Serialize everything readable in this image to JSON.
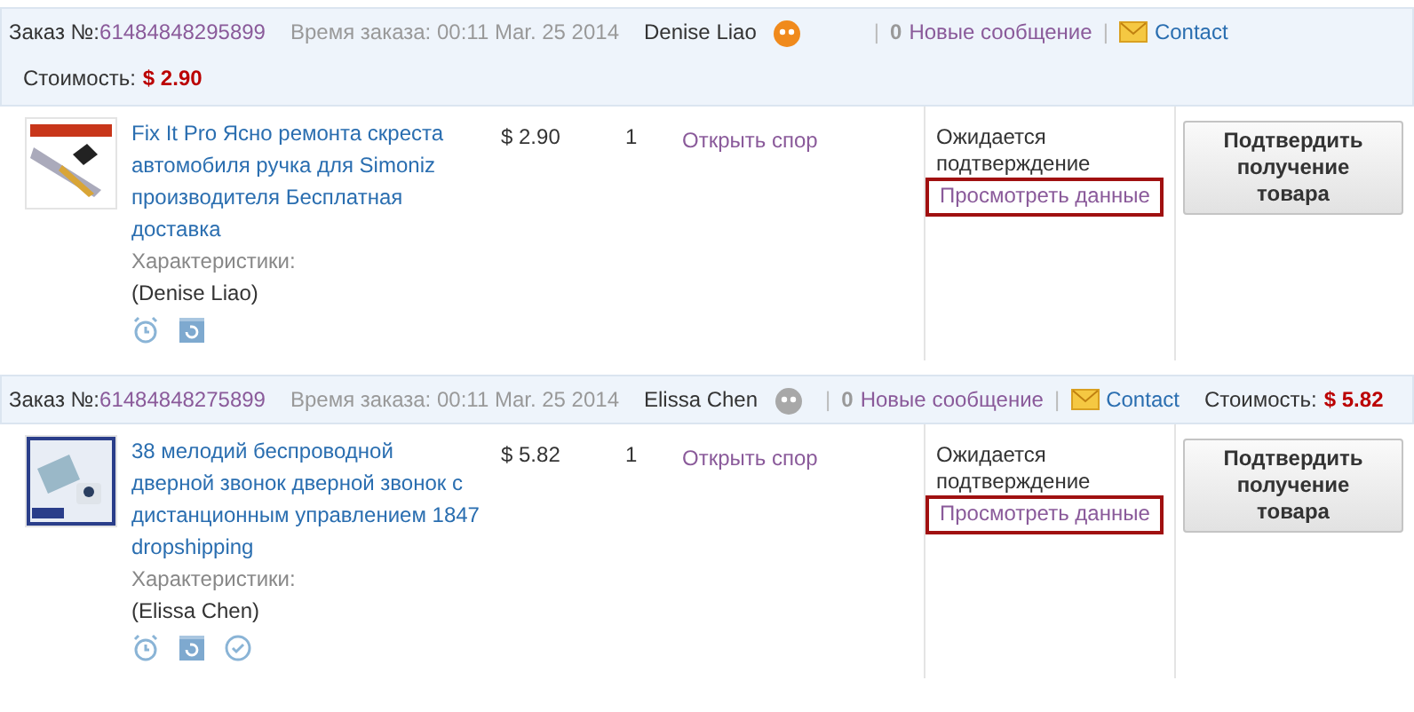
{
  "orders": [
    {
      "order_label": "Заказ №:",
      "order_number": "61484848295899",
      "time_label": "Время заказа: 00:11 Mar. 25 2014",
      "seller": "Denise Liao",
      "seller_online": true,
      "separator_1": "|",
      "messages_count": "0",
      "messages_label": "Новые сообщение",
      "separator_2": "|",
      "contact": "Contact",
      "cost_label": "Стоимость:",
      "cost": "$ 2.90",
      "cost_on_second_line": true,
      "item": {
        "title": "Fix It Pro Ясно ремонта скреста автомобиля ручка для Simoniz производителя Бесплатная доставка",
        "specs_label": "Характеристики:",
        "specs_value": "(Denise Liao)",
        "price": "$ 2.90",
        "quantity": "1",
        "dispute": "Открыть спор",
        "status": "Ожидается подтверждение",
        "details_link": "Просмотреть данные",
        "details_highlighted": true,
        "confirm_button": "Подтвердить получение товара",
        "icons": [
          {
            "kind": "alarm"
          },
          {
            "kind": "refresh"
          }
        ]
      }
    },
    {
      "order_label": "Заказ №:",
      "order_number": "61484848275899",
      "time_label": "Время заказа: 00:11 Mar. 25 2014",
      "seller": "Elissa Chen",
      "seller_online": false,
      "separator_1": "|",
      "messages_count": "0",
      "messages_label": "Новые сообщение",
      "separator_2": "|",
      "contact": "Contact",
      "cost_label": "Стоимость:",
      "cost": "$ 5.82",
      "cost_on_second_line": false,
      "item": {
        "title": "38 мелодий беспроводной дверной звонок дверной звонок с дистанционным управлением 1847 dropshipping",
        "specs_label": "Характеристики:",
        "specs_value": "(Elissa Chen)",
        "price": "$ 5.82",
        "quantity": "1",
        "dispute": "Открыть спор",
        "status": "Ожидается подтверждение",
        "details_link": "Просмотреть данные",
        "details_highlighted": true,
        "confirm_button": "Подтвердить получение товара",
        "icons": [
          {
            "kind": "alarm"
          },
          {
            "kind": "refresh"
          },
          {
            "kind": "check"
          }
        ]
      }
    }
  ]
}
